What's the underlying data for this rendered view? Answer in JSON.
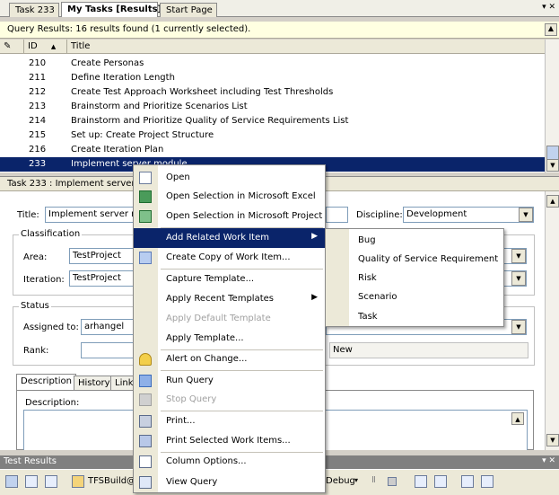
{
  "tabs": [
    {
      "label": "Task 233"
    },
    {
      "label": "My Tasks [Results]"
    },
    {
      "label": "Start Page"
    }
  ],
  "query": {
    "summary": "Query Results: 16 results found (1 currently selected).",
    "columns": {
      "id": "ID",
      "title": "Title"
    },
    "rows": [
      {
        "id": "210",
        "title": "Create Personas"
      },
      {
        "id": "211",
        "title": "Define Iteration Length"
      },
      {
        "id": "212",
        "title": "Create Test Approach Worksheet including Test Thresholds"
      },
      {
        "id": "213",
        "title": "Brainstorm and Prioritize Scenarios List"
      },
      {
        "id": "214",
        "title": "Brainstorm and Prioritize Quality of Service Requirements List"
      },
      {
        "id": "215",
        "title": "Set up: Create Project Structure"
      },
      {
        "id": "216",
        "title": "Create Iteration Plan"
      },
      {
        "id": "233",
        "title": "Implement server module"
      }
    ]
  },
  "work_item": {
    "header": "Task 233 : Implement server m",
    "title_label": "Title:",
    "title_value": "Implement server mo",
    "discipline_label": "Discipline:",
    "discipline_value": "Development",
    "classification_label": "Classification",
    "area_label": "Area:",
    "area_value": "TestProject",
    "iteration_label": "Iteration:",
    "iteration_value": "TestProject",
    "status_label": "Status",
    "assigned_label": "Assigned to:",
    "assigned_value": "arhangel",
    "rank_label": "Rank:",
    "state_value": "New",
    "tabs": [
      "Description",
      "History",
      "Links"
    ],
    "description_label": "Description:"
  },
  "context_menu": {
    "items": [
      {
        "label": "Open",
        "icon": "open-icon"
      },
      {
        "label": "Open Selection in Microsoft Excel",
        "icon": "excel-icon"
      },
      {
        "label": "Open Selection in Microsoft Project",
        "icon": "project-icon"
      },
      {
        "label": "Add Related Work Item",
        "icon": ""
      },
      {
        "label": "Create Copy of Work Item...",
        "icon": "copy-icon"
      },
      {
        "label": "Capture Template...",
        "icon": ""
      },
      {
        "label": "Apply Recent Templates",
        "icon": ""
      },
      {
        "label": "Apply Default Template",
        "icon": ""
      },
      {
        "label": "Apply Template...",
        "icon": ""
      },
      {
        "label": "Alert on Change...",
        "icon": "alert-icon"
      },
      {
        "label": "Run Query",
        "icon": "run-query-icon"
      },
      {
        "label": "Stop Query",
        "icon": "stop-query-icon"
      },
      {
        "label": "Print...",
        "icon": "print-icon"
      },
      {
        "label": "Print Selected Work Items...",
        "icon": "print-selected-icon"
      },
      {
        "label": "Column Options...",
        "icon": "column-options-icon"
      },
      {
        "label": "View Query",
        "icon": "view-query-icon"
      }
    ]
  },
  "submenu": {
    "items": [
      "Bug",
      "Quality of Service Requirement",
      "Risk",
      "Scenario",
      "Task"
    ]
  },
  "test_results": {
    "title": "Test Results",
    "build_label": "TFSBuild@",
    "config_label": "Debug"
  },
  "colors": {
    "selection": "#0a246a",
    "info_bar": "#ffffe1",
    "menu_gutter": "#ece9d8"
  }
}
